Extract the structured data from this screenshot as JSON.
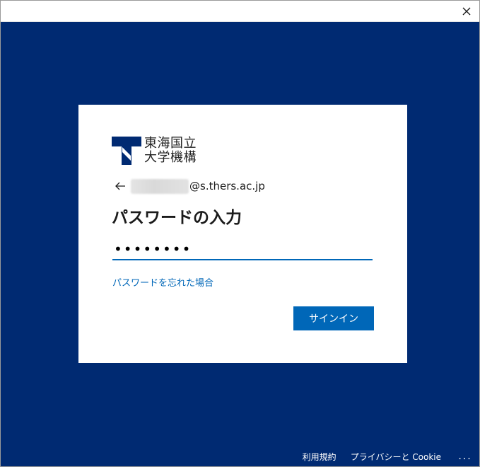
{
  "window": {
    "close_icon": "close-icon"
  },
  "logo": {
    "line1": "東海国立",
    "line2": "大学機構",
    "mark_icon": "tokai-t-logo"
  },
  "identity": {
    "back_icon": "arrow-left-icon",
    "username_redacted": "",
    "domain": "@s.thers.ac.jp"
  },
  "form": {
    "title": "パスワードの入力",
    "password_value": "••••••••",
    "forgot_link": "パスワードを忘れた場合",
    "signin_button": "サインイン"
  },
  "footer": {
    "terms": "利用規約",
    "privacy": "プライバシーと Cookie",
    "more": "..."
  },
  "colors": {
    "background": "#002a72",
    "accent": "#0067b8",
    "card": "#ffffff"
  }
}
